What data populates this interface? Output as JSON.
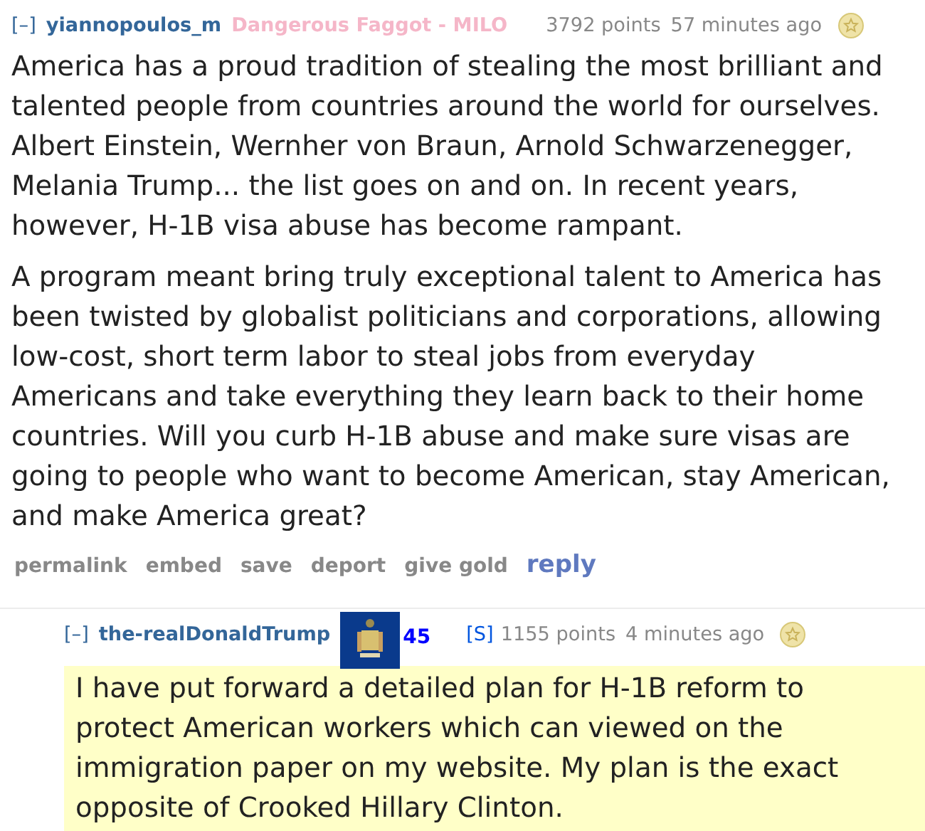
{
  "comments": [
    {
      "collapse": "[–]",
      "author": "yiannopoulos_m",
      "flair": "Dangerous Faggot - MILO",
      "score": "3792 points",
      "time": "57 minutes ago",
      "highlighted": false,
      "paragraphs": [
        "America has a proud tradition of stealing the most brilliant and talented people from countries around the world for ourselves. Albert Einstein, Wernher von Braun, Arnold Schwarzenegger, Melania Trump... the list goes on and on. In recent years, however, H-1B visa abuse has become rampant.",
        "A program meant bring truly exceptional talent to America has been twisted by globalist politicians and corporations, allowing low-cost, short term labor to steal jobs from everyday Americans and take everything they learn back to their home countries. Will you curb H-1B abuse and make sure visas are going to people who want to become American, stay American, and make America great?"
      ],
      "actions": [
        {
          "label": "permalink",
          "kind": "link"
        },
        {
          "label": "embed",
          "kind": "link"
        },
        {
          "label": "save",
          "kind": "link"
        },
        {
          "label": "deport",
          "kind": "link"
        },
        {
          "label": "give gold",
          "kind": "link"
        },
        {
          "label": "reply",
          "kind": "reply"
        }
      ]
    },
    {
      "collapse": "[–]",
      "author": "the-realDonaldTrump",
      "flair_number": "45",
      "submitter": "[S]",
      "score": "1155 points",
      "time": "4 minutes ago",
      "highlighted": true,
      "paragraphs": [
        "I have put forward a detailed plan for H-1B reform to protect American workers which can viewed on the immigration paper on my website. My plan is the exact opposite of Crooked Hillary Clinton."
      ]
    }
  ]
}
